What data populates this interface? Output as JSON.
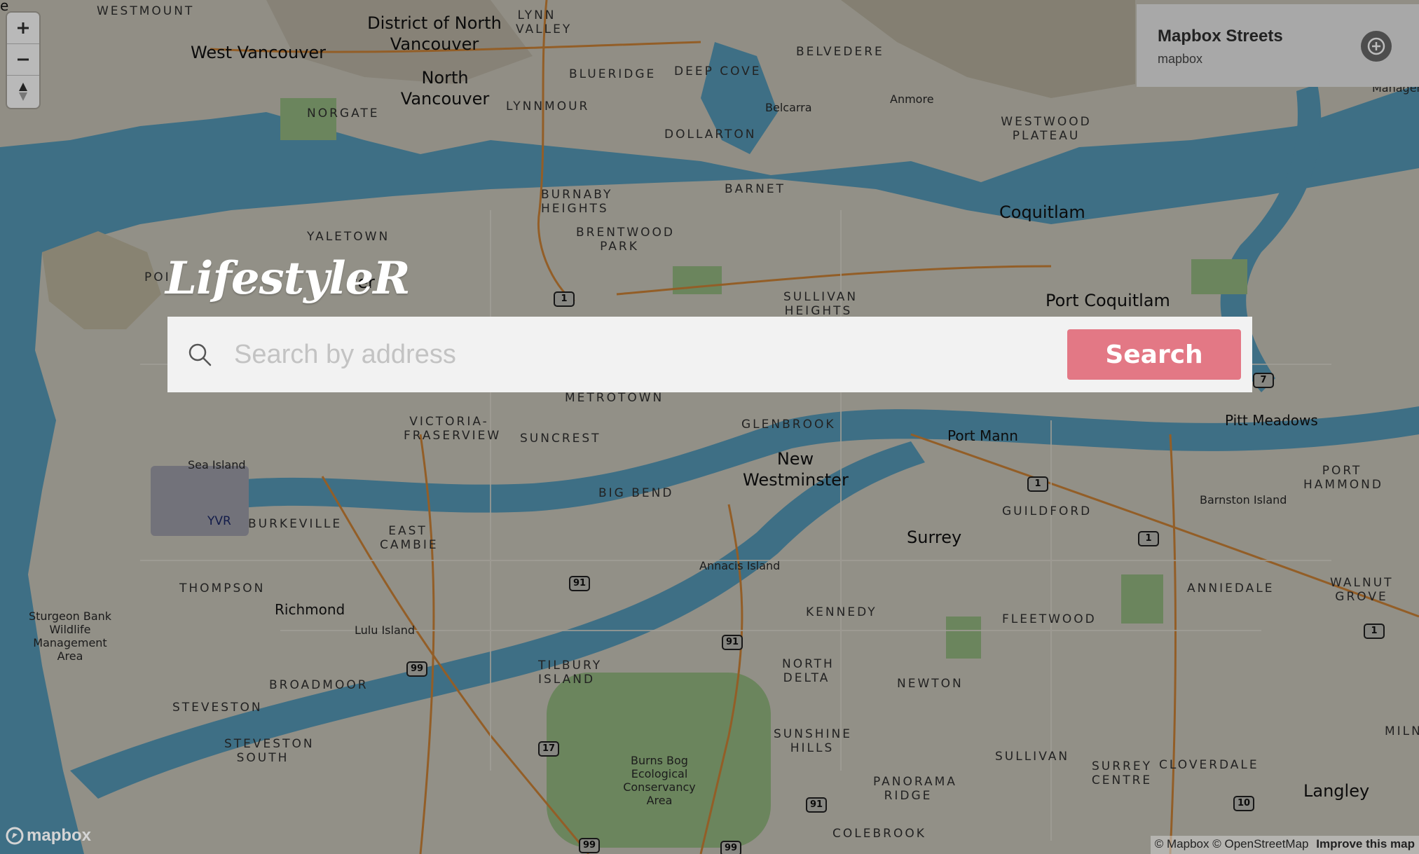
{
  "colors": {
    "water": "#5ca4c4",
    "land": "#d8d4c8",
    "park": "#9ec48a",
    "accent": "#e37885",
    "search_bg": "#f2f2f2"
  },
  "map_controls": {
    "zoom_in_icon": "plus-icon",
    "zoom_out_icon": "minus-icon",
    "compass_icon": "compass-icon"
  },
  "style_switcher": {
    "title": "Mapbox Streets",
    "subtitle": "mapbox",
    "icon": "style-switch-icon"
  },
  "app": {
    "logo": "LifestyleR"
  },
  "search": {
    "placeholder": "Search by address",
    "value": "",
    "button_label": "Search"
  },
  "map_labels": {
    "westmount": "WESTMOUNT",
    "west_vancouver": "West Vancouver",
    "district_north_vancouver": "District of North Vancouver",
    "lynn_valley": "LYNN VALLEY",
    "north_vancouver": "North Vancouver",
    "blueridge": "BLUERIDGE",
    "deep_cove": "DEEP COVE",
    "belvedere": "BELVEDERE",
    "belcarra": "Belcarra",
    "anmore": "Anmore",
    "norgate": "NORGATE",
    "lynnmour": "LYNNMOUR",
    "dollarton": "DOLLARTON",
    "westwood_plateau": "WESTWOOD PLATEAU",
    "managem": "Managem",
    "burnaby_heights": "BURNABY HEIGHTS",
    "barnet": "BARNET",
    "coquitlam": "Coquitlam",
    "brentwood_park": "BRENTWOOD PARK",
    "yaletown": "YALETOWN",
    "vancouver_partial": "ver",
    "point_partial": "POI",
    "sullivan_heights": "SULLIVAN HEIGHTS",
    "port_coquitlam": "Port Coquitlam",
    "metrotown": "METROTOWN",
    "victoria_fraserview": "VICTORIA-FRASERVIEW",
    "suncrest": "SUNCREST",
    "glenbrook": "GLENBROOK",
    "port_mann": "Port Mann",
    "pitt_meadows": "Pitt Meadows",
    "new_westminster": "New Westminster",
    "sea_island": "Sea Island",
    "yvr": "YVR",
    "burkeville": "BURKEVILLE",
    "big_bend": "BIG BEND",
    "east_cambie": "EAST CAMBIE",
    "guildford": "GUILDFORD",
    "barnston_island": "Barnston Island",
    "port_hammond": "PORT HAMMOND",
    "surrey": "Surrey",
    "annacis_island": "Annacis Island",
    "thompson": "THOMPSON",
    "richmond": "Richmond",
    "lulu_island": "Lulu Island",
    "kennedy": "KENNEDY",
    "anniedale": "ANNIEDALE",
    "walnut_grove": "WALNUT GROVE",
    "fleetwood": "FLEETWOOD",
    "sturgeon_bank": "Sturgeon Bank Wildlife Management Area",
    "broadmoor": "BROADMOOR",
    "tilbury_island": "TILBURY ISLAND",
    "north_delta": "NORTH DELTA",
    "newton": "NEWTON",
    "steveston": "STEVESTON",
    "steveston_south": "STEVESTON SOUTH",
    "sunshine_hills": "SUNSHINE HILLS",
    "burns_bog": "Burns Bog Ecological Conservancy Area",
    "sullivan": "SULLIVAN",
    "surrey_centre": "SURREY CENTRE",
    "cloverdale": "CLOVERDALE",
    "milner_partial": "MILN",
    "panorama_ridge": "PANORAMA RIDGE",
    "langley": "Langley",
    "colebrook": "COLEBROOK",
    "edge_partial": "e"
  },
  "highway_shields": [
    "1",
    "7",
    "1",
    "1",
    "1",
    "91",
    "91",
    "99",
    "91",
    "17",
    "91",
    "10",
    "99",
    "99"
  ],
  "footer": {
    "mapbox_logo": "mapbox",
    "attribution_mapbox": "© Mapbox",
    "attribution_osm": "© OpenStreetMap",
    "improve": "Improve this map"
  }
}
